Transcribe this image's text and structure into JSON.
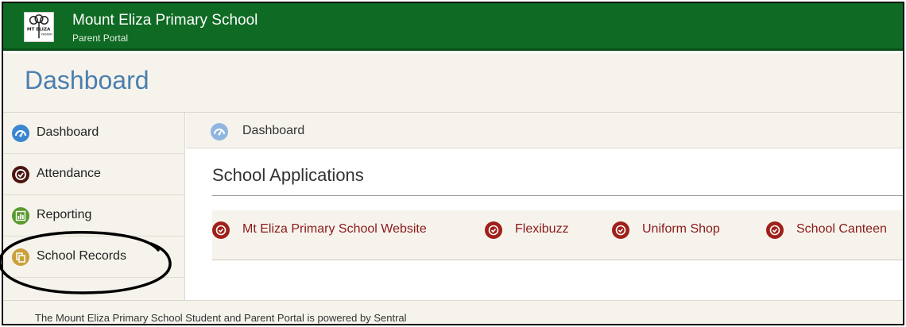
{
  "header": {
    "school_name": "Mount Eliza Primary School",
    "subtitle": "Parent Portal",
    "logo_text": "MT ELIZA",
    "bg_color": "#0f6a23"
  },
  "page": {
    "title": "Dashboard"
  },
  "sidebar": {
    "items": [
      {
        "label": "Dashboard",
        "icon": "dashboard-gauge-icon",
        "color": "#3a86d0"
      },
      {
        "label": "Attendance",
        "icon": "attendance-check-icon",
        "color": "#5a1a14"
      },
      {
        "label": "Reporting",
        "icon": "reporting-chart-icon",
        "color": "#5a9a2e"
      },
      {
        "label": "School Records",
        "icon": "school-records-icon",
        "color": "#c9a03a"
      }
    ]
  },
  "breadcrumb": {
    "label": "Dashboard",
    "icon": "dashboard-gauge-icon"
  },
  "applications": {
    "heading": "School Applications",
    "items": [
      {
        "label": "Mt Eliza Primary School Website",
        "icon": "app-link-icon"
      },
      {
        "label": "Flexibuzz",
        "icon": "app-link-icon"
      },
      {
        "label": "Uniform Shop",
        "icon": "app-link-icon"
      },
      {
        "label": "School Canteen",
        "icon": "app-link-icon"
      }
    ],
    "link_color": "#8a1a1a",
    "icon_color": "#a0201a"
  },
  "footer": {
    "text": "The Mount Eliza Primary School Student and Parent Portal is powered by Sentral"
  }
}
